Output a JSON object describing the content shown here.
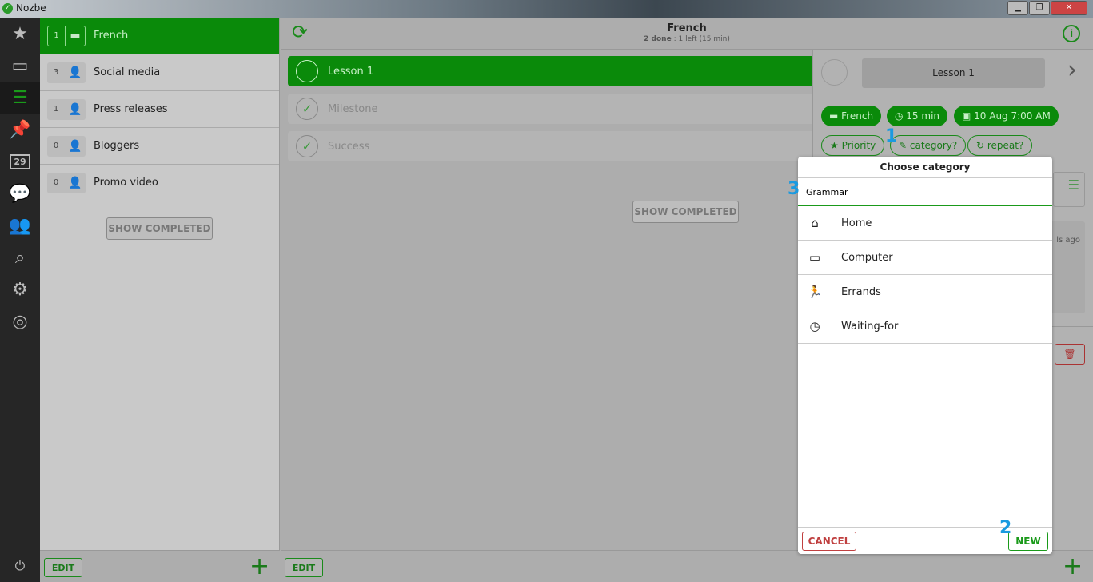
{
  "window": {
    "title": "Nozbe",
    "controls": [
      "minimize",
      "maximize",
      "close"
    ]
  },
  "nav": {
    "items": [
      {
        "name": "priority",
        "icon": "star-icon"
      },
      {
        "name": "inbox",
        "icon": "inbox-icon"
      },
      {
        "name": "projects",
        "icon": "projects-icon",
        "active": true
      },
      {
        "name": "categories",
        "icon": "pin-icon"
      },
      {
        "name": "calendar",
        "icon": "calendar-icon",
        "label": "29"
      },
      {
        "name": "comments",
        "icon": "chat-icon"
      },
      {
        "name": "team",
        "icon": "team-icon"
      },
      {
        "name": "search",
        "icon": "search-icon"
      },
      {
        "name": "settings",
        "icon": "gear-icon"
      },
      {
        "name": "help",
        "icon": "lifebuoy-icon"
      }
    ],
    "power_icon": "power-icon"
  },
  "projects": {
    "items": [
      {
        "count": "1",
        "label": "French",
        "icon": "folder-icon",
        "active": true
      },
      {
        "count": "3",
        "label": "Social media",
        "icon": "person-icon"
      },
      {
        "count": "1",
        "label": "Press releases",
        "icon": "person-icon"
      },
      {
        "count": "0",
        "label": "Bloggers",
        "icon": "person-icon"
      },
      {
        "count": "0",
        "label": "Promo video",
        "icon": "person-icon"
      }
    ],
    "show_completed": "SHOW COMPLETED",
    "edit": "EDIT"
  },
  "main": {
    "title": "French",
    "done": "2 done",
    "separator": ":",
    "left": "1 left (15 min)",
    "tasks": [
      {
        "label": "Lesson 1",
        "active": true
      },
      {
        "label": "Milestone",
        "done": true
      },
      {
        "label": "Success",
        "done": true
      }
    ],
    "show_completed": "SHOW COMPLETED",
    "edit": "EDIT"
  },
  "detail": {
    "task_name": "Lesson 1",
    "project": "French",
    "time": "15 min",
    "date": "10 Aug 7:00 AM",
    "priority": "Priority",
    "category": "category?",
    "repeat": "repeat?",
    "partial": "ls ago"
  },
  "modal": {
    "title": "Choose category",
    "input_value": "Grammar",
    "categories": [
      {
        "label": "Home",
        "icon": "home-icon"
      },
      {
        "label": "Computer",
        "icon": "monitor-icon"
      },
      {
        "label": "Errands",
        "icon": "running-icon"
      },
      {
        "label": "Waiting-for",
        "icon": "clock-icon"
      }
    ],
    "cancel": "CANCEL",
    "new": "NEW"
  },
  "annotations": [
    "1",
    "2",
    "3"
  ],
  "colors": {
    "accent": "#0a8a0a",
    "cancel": "#c04040",
    "annotation": "#1a9ae0"
  }
}
